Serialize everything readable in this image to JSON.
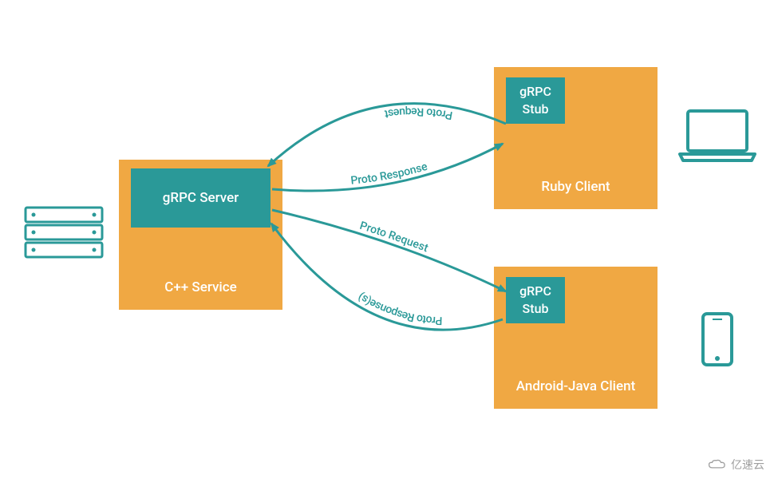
{
  "colors": {
    "accent_teal": "#2a9998",
    "box_orange": "#f0a843"
  },
  "server": {
    "block_label": "C++ Service",
    "header_label": "gRPC Server"
  },
  "ruby_client": {
    "block_label": "Ruby Client",
    "stub_label_line1": "gRPC",
    "stub_label_line2": "Stub"
  },
  "android_client": {
    "block_label": "Android-Java Client",
    "stub_label_line1": "gRPC",
    "stub_label_line2": "Stub"
  },
  "arrows": {
    "ruby_request": "Proto Request",
    "ruby_response": "Proto Response",
    "android_request": "Proto Request",
    "android_response": "Proto Response(s)"
  },
  "watermark": "亿速云"
}
